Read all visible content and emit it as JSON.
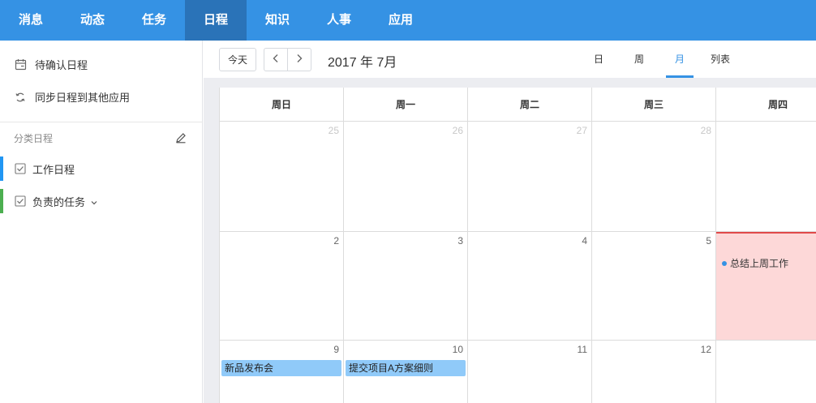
{
  "nav": {
    "items": [
      {
        "label": "消息"
      },
      {
        "label": "动态"
      },
      {
        "label": "任务"
      },
      {
        "label": "日程"
      },
      {
        "label": "知识"
      },
      {
        "label": "人事"
      },
      {
        "label": "应用"
      }
    ],
    "active": "日程"
  },
  "sidebar": {
    "actions": [
      {
        "label": "待确认日程",
        "icon": "calendar-pending-icon"
      },
      {
        "label": "同步日程到其他应用",
        "icon": "sync-icon"
      }
    ],
    "section_title": "分类日程",
    "categories": [
      {
        "label": "工作日程",
        "color": "#2196f3"
      },
      {
        "label": "负责的任务",
        "color": "#4caf50"
      }
    ]
  },
  "toolbar": {
    "today_label": "今天",
    "month_title": "2017 年 7月",
    "views": [
      {
        "label": "日"
      },
      {
        "label": "周"
      },
      {
        "label": "月"
      },
      {
        "label": "列表"
      }
    ],
    "active_view": "月"
  },
  "calendar": {
    "weekdays": [
      "周日",
      "周一",
      "周二",
      "周三",
      "周四"
    ],
    "weeks": [
      {
        "days": [
          "25",
          "26",
          "27",
          "28",
          ""
        ]
      },
      {
        "days": [
          "2",
          "3",
          "4",
          "5",
          ""
        ]
      },
      {
        "days": [
          "9",
          "10",
          "11",
          "12",
          ""
        ]
      }
    ],
    "events": {
      "today_event": "总结上周工作",
      "product_launch": "新品发布会",
      "submit_plan": "提交项目A方案细则"
    }
  },
  "colors": {
    "accent": "#3592e4",
    "nav_active": "#2a73b8",
    "today_bg": "#fdd8d8",
    "today_border": "#e04a4a",
    "event_bar": "#90caf9"
  }
}
